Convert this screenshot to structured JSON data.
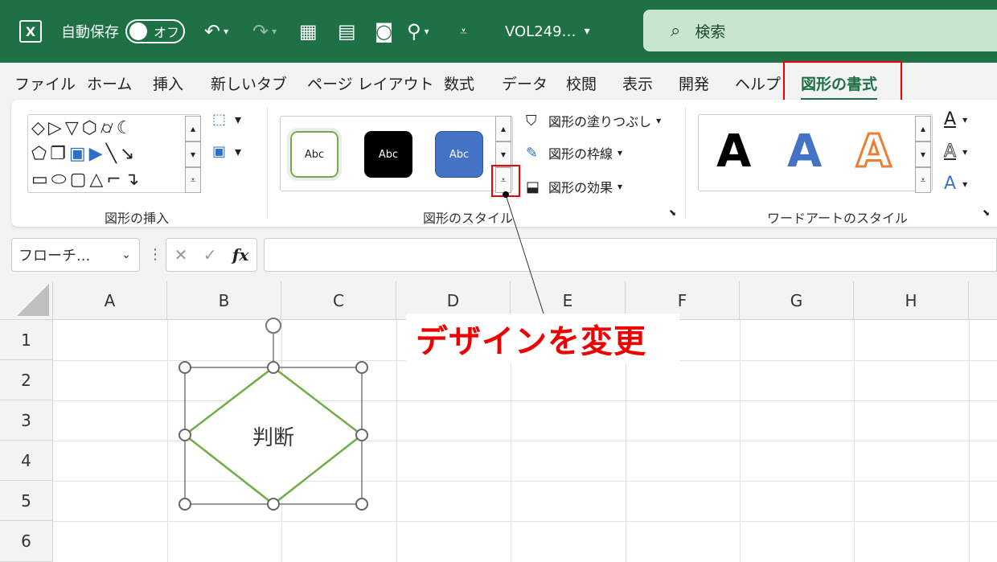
{
  "titlebar": {
    "app_icon": "excel-icon",
    "autosave_label": "自動保存",
    "autosave_state": "オフ",
    "filename": "VOL249…",
    "search_placeholder": "検索"
  },
  "tabs": [
    "ファイル",
    "ホーム",
    "挿入",
    "新しいタブ",
    "ページ レイアウト",
    "数式",
    "データ",
    "校閲",
    "表示",
    "開発",
    "ヘルプ",
    "図形の書式"
  ],
  "active_tab": "図形の書式",
  "ribbon": {
    "insert_group_label": "図形の挿入",
    "style_group_label": "図形のスタイル",
    "wordart_group_label": "ワードアートのスタイル",
    "style_swatch_text": "Abc",
    "fill_label": "図形の塗りつぶし",
    "outline_label": "図形の枠線",
    "effects_label": "図形の効果",
    "wordart_letter": "A",
    "colors": {
      "swatch_outline": "#70ad47",
      "swatch_dark": "#000000",
      "swatch_blue": "#4472c4",
      "wordart_blue": "#4472c4",
      "wordart_orange": "#ed7d31"
    }
  },
  "formula_bar": {
    "name_box": "フローチ...",
    "fx": "fx",
    "formula": ""
  },
  "grid": {
    "columns": [
      "A",
      "B",
      "C",
      "D",
      "E",
      "F",
      "G",
      "H"
    ],
    "rows": [
      "1",
      "2",
      "3",
      "4",
      "5",
      "6"
    ]
  },
  "shape": {
    "text": "判断",
    "outline_color": "#70ad47"
  },
  "annotation": {
    "text": "デザインを変更",
    "color": "#e00000"
  }
}
